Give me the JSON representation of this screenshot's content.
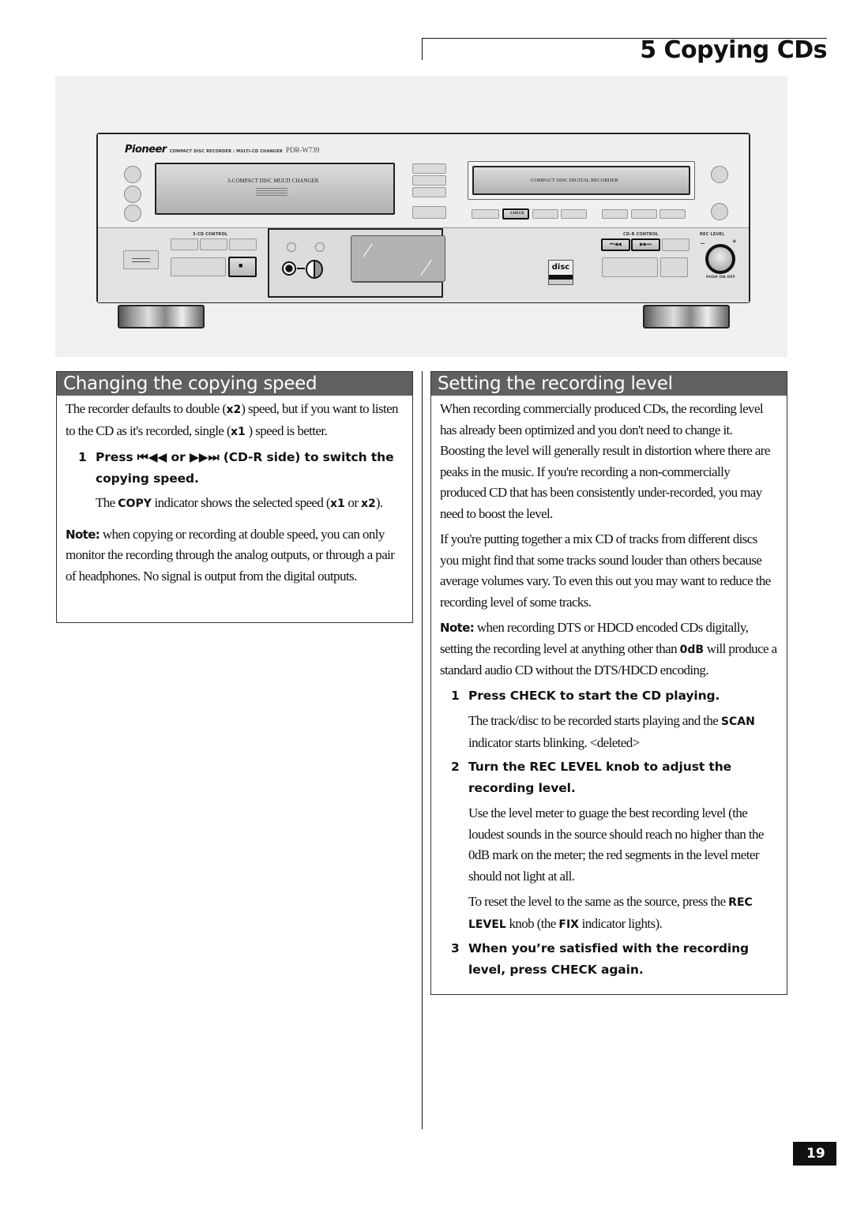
{
  "header": {
    "chapter_title": "5 Copying CDs"
  },
  "illustration": {
    "brand": "Pioneer",
    "product_description": "COMPACT DISC RECORDER / MULTI-CD CHANGER",
    "model": "PDR-W739",
    "left_tray_label": "3-COMPACT DISC MULTI CHANGER",
    "right_tray_label": "COMPACT DISC DIGITAL RECORDER",
    "check_button": "CHECK",
    "cd_control_label": "3-CD CONTROL",
    "cdr_control_label": "CD-R CONTROL",
    "rec_level_label": "REC LEVEL",
    "knob_minus": "–",
    "knob_plus": "+",
    "push_label": "PUSH ON-OFF",
    "prev_button": "⏮◀◀",
    "next_button": "▶▶⏭",
    "stop_symbol": "■",
    "disc_logo": "disc"
  },
  "left_section": {
    "title": "Changing the copying speed",
    "intro": {
      "t1": "The recorder defaults to double (",
      "b1": "x2",
      "t2": ") speed, but if you want to listen to the CD as it's recorded, single (",
      "b2": "x1",
      "t3": " ) speed is better."
    },
    "step1": {
      "number": "1",
      "text": "Press ⏮◀◀ or ▶▶⏭ (CD-R side) to switch the copying speed.",
      "detail": {
        "t1": "The ",
        "b1": "COPY",
        "t2": " indicator shows the selected speed (",
        "b2": "x1",
        "t3": "  or ",
        "b3": "x2",
        "t4": ")."
      }
    },
    "note": {
      "label": "Note:",
      "text": " when copying or recording at double speed, you can only monitor the recording through the analog outputs, or through a pair of headphones. No signal is output from the digital outputs."
    }
  },
  "right_section": {
    "title": "Setting the recording level",
    "para1": "When recording commercially produced CDs, the recording level has already been optimized and you don't need to change it. Boosting the level will generally result in distortion where there are peaks in the music. If you're recording a non-commercially produced CD that has been consistently under-recorded, you may need to boost the level.",
    "para2": "If you're putting together a mix CD of tracks from different discs you might find that some tracks sound louder than others because  average volumes vary. To even this out you may want to reduce the recording level of some tracks.",
    "note": {
      "label": "Note:",
      "t1": " when recording DTS or HDCD encoded CDs digitally, setting the recording level at anything other than ",
      "b1": "0dB",
      "t2": " will produce a standard audio CD without the DTS/HDCD encoding."
    },
    "steps": [
      {
        "number": "1",
        "text": "Press CHECK to start the CD playing.",
        "detail": {
          "t1": "The track/disc to be recorded starts playing and the ",
          "b1": "SCAN",
          "t2": " indicator starts blinking. <deleted>"
        }
      },
      {
        "number": "2",
        "text": "Turn the REC LEVEL knob to adjust the recording level.",
        "detail1": "Use the level meter to guage the best recording level (the loudest sounds in the source should reach no higher than the 0dB mark on the meter; the red segments in the level meter should not light at all.",
        "detail2": {
          "t1": "To reset the level to the same as the source, press the ",
          "b1": "REC LEVEL",
          "t2": " knob (the ",
          "b2": "FIX",
          "t3": " indicator lights)."
        }
      },
      {
        "number": "3",
        "text": "When you’re satisfied with the recording level, press CHECK again."
      }
    ]
  },
  "footer": {
    "page_number": "19"
  }
}
